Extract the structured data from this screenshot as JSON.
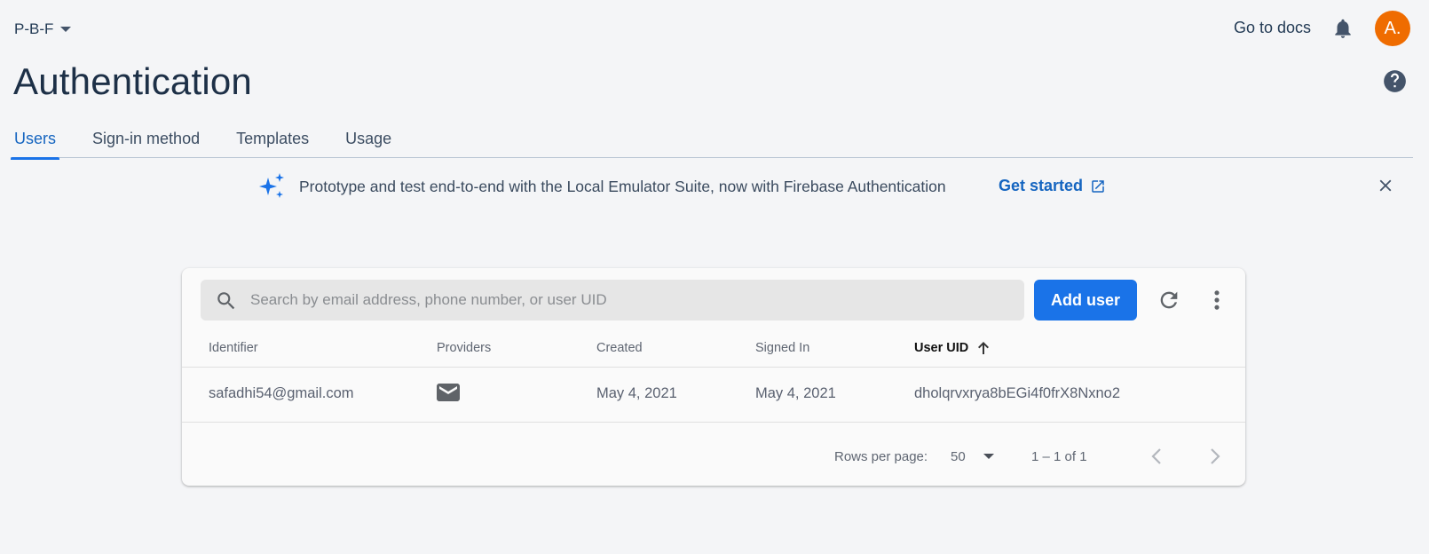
{
  "header": {
    "project_name": "P-B-F",
    "go_to_docs": "Go to docs",
    "avatar_initial": "A."
  },
  "page": {
    "title": "Authentication"
  },
  "tabs": [
    {
      "label": "Users",
      "active": true
    },
    {
      "label": "Sign-in method",
      "active": false
    },
    {
      "label": "Templates",
      "active": false
    },
    {
      "label": "Usage",
      "active": false
    }
  ],
  "banner": {
    "text": "Prototype and test end-to-end with the Local Emulator Suite, now with Firebase Authentication",
    "link_label": "Get started"
  },
  "users_table": {
    "search_placeholder": "Search by email address, phone number, or user UID",
    "add_user_label": "Add user",
    "columns": [
      "Identifier",
      "Providers",
      "Created",
      "Signed In",
      "User UID"
    ],
    "sorted_column": "User UID",
    "sort_direction": "ascending",
    "rows": [
      {
        "identifier": "safadhi54@gmail.com",
        "provider_icon": "email-icon",
        "created": "May 4, 2021",
        "signed_in": "May 4, 2021",
        "uid": "dholqrvxrya8bEGi4f0frX8Nxno2"
      }
    ],
    "rows_per_page_label": "Rows per page:",
    "rows_per_page_value": "50",
    "page_range": "1 – 1 of 1"
  },
  "colors": {
    "accent": "#1a73e8",
    "avatar": "#ef6c00",
    "background": "#f4f5f7"
  }
}
